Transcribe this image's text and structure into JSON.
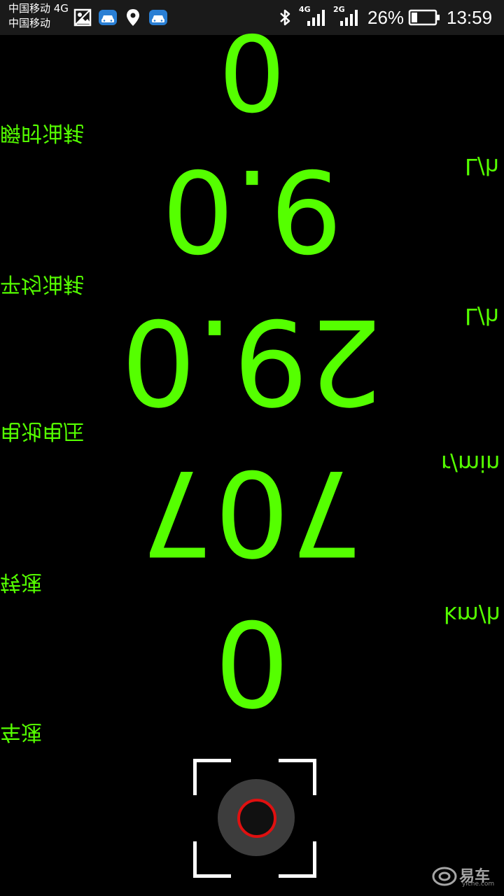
{
  "status_bar": {
    "carrier_1": "中国移动 4G",
    "carrier_2": "中国移动",
    "net_4g": "4G",
    "net_2g": "2G",
    "battery_percent": "26%",
    "battery_level": 0.26,
    "time": "13:59",
    "icons": [
      "gallery-icon",
      "car-app-icon",
      "location-icon",
      "car-app-icon",
      "bluetooth-icon",
      "signal-icon",
      "signal-icon",
      "battery-icon"
    ]
  },
  "hud": {
    "mirrored": true,
    "text_color": "#55ff00",
    "rows": [
      {
        "label": "瞬时油耗",
        "value": "0",
        "unit": "L/h"
      },
      {
        "label": "平均油耗",
        "value": "9.0",
        "unit": "L/h"
      },
      {
        "label": "电池电压",
        "value": "29.0",
        "unit": "r/min"
      },
      {
        "label": "转速",
        "value": "707",
        "unit": "km/h"
      },
      {
        "label": "车速",
        "value": "0",
        "unit": ""
      }
    ]
  },
  "controls": {
    "shutter": "shutter-button",
    "shutter_ring_color": "#e01010"
  },
  "watermark": {
    "text": "易车",
    "sub": "yiche.com"
  }
}
